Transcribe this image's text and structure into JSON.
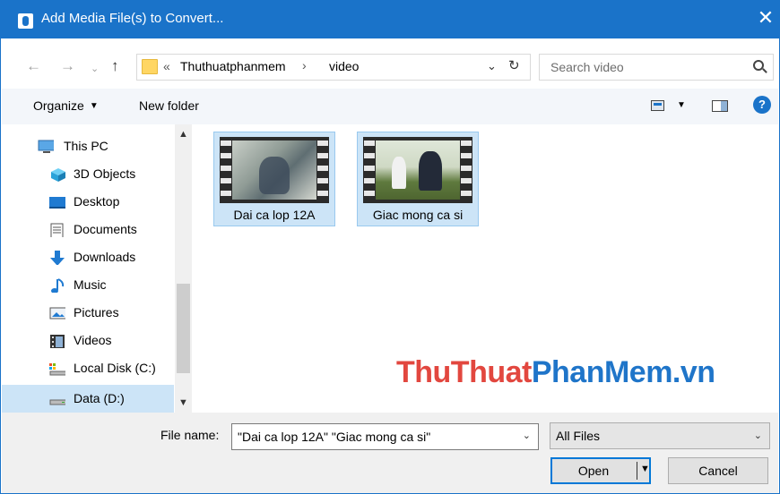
{
  "window": {
    "title": "Add Media File(s) to Convert..."
  },
  "address": {
    "path": [
      "Thuthuatphanmem",
      "video"
    ],
    "overflow_chevron": "«",
    "separator": "›"
  },
  "search": {
    "placeholder": "Search video"
  },
  "toolbar": {
    "organize_label": "Organize",
    "new_folder_label": "New folder",
    "help_label": "?"
  },
  "nav": {
    "items": [
      {
        "label": "This PC",
        "icon": "this-pc-icon"
      },
      {
        "label": "3D Objects",
        "icon": "3d-objects-icon"
      },
      {
        "label": "Desktop",
        "icon": "desktop-icon"
      },
      {
        "label": "Documents",
        "icon": "documents-icon"
      },
      {
        "label": "Downloads",
        "icon": "downloads-icon"
      },
      {
        "label": "Music",
        "icon": "music-icon"
      },
      {
        "label": "Pictures",
        "icon": "pictures-icon"
      },
      {
        "label": "Videos",
        "icon": "videos-icon"
      },
      {
        "label": "Local Disk (C:)",
        "icon": "local-disk-icon"
      },
      {
        "label": "Data (D:)",
        "icon": "drive-icon",
        "selected": true
      }
    ]
  },
  "files": [
    {
      "name": "Dai ca lop 12A",
      "selected": true
    },
    {
      "name": "Giac mong ca si",
      "selected": true
    }
  ],
  "watermark": {
    "part1": "ThuThuat",
    "part2": "PhanMem.vn"
  },
  "bottom": {
    "file_name_label": "File name:",
    "file_name_value": "\"Dai ca lop 12A\" \"Giac mong ca si\"",
    "filter_value": "All Files",
    "open_label": "Open",
    "cancel_label": "Cancel"
  },
  "colors": {
    "accent": "#1a73c9",
    "selection": "#cce4f7",
    "watermark_red": "#e2473f",
    "watermark_blue": "#1f75c9"
  }
}
